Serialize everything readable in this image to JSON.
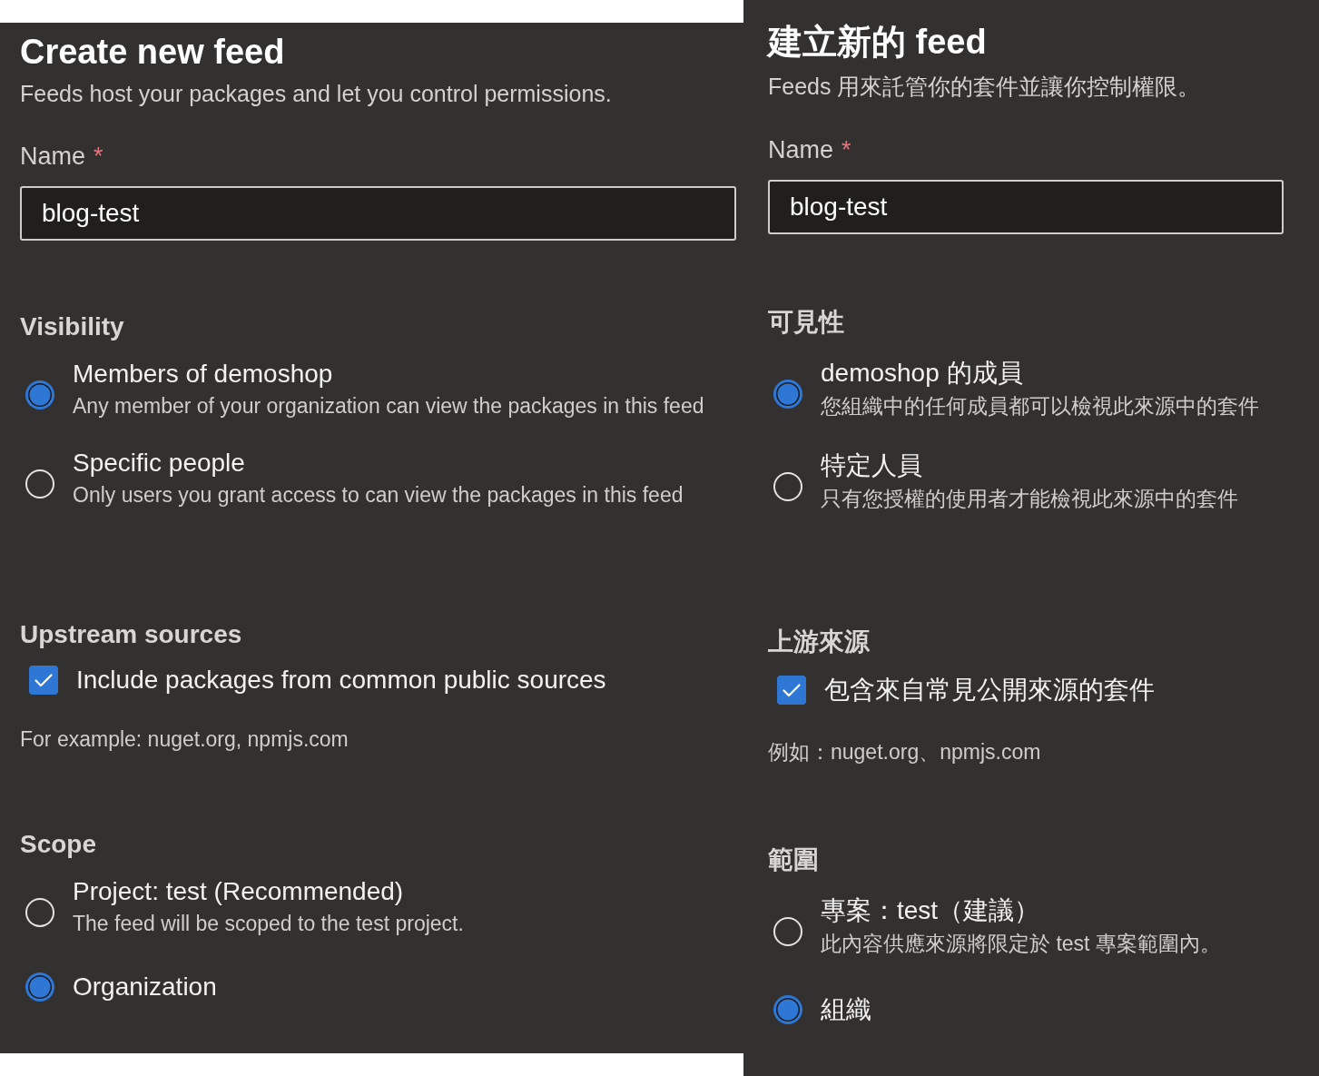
{
  "panels": [
    {
      "title": "Create new feed",
      "subtitle": "Feeds host your packages and let you control permissions.",
      "name_field": {
        "label": "Name",
        "required_mark": "*",
        "value": "blog-test"
      },
      "sections": [
        {
          "kind": "radio",
          "heading": "Visibility",
          "options": [
            {
              "label": "Members of demoshop",
              "description": "Any member of your organization can view the packages in this feed",
              "selected": true
            },
            {
              "label": "Specific people",
              "description": "Only users you grant access to can view the packages in this feed",
              "selected": false
            }
          ]
        },
        {
          "kind": "checkbox",
          "heading": "Upstream sources",
          "options": [
            {
              "label": "Include packages from common public sources",
              "checked": true
            }
          ],
          "note": "For example: nuget.org, npmjs.com"
        },
        {
          "kind": "radio",
          "heading": "Scope",
          "options": [
            {
              "label": "Project: test (Recommended)",
              "description": "The feed will be scoped to the test project.",
              "selected": false
            },
            {
              "label": "Organization",
              "selected": true
            }
          ]
        }
      ]
    },
    {
      "title": "建立新的 feed",
      "subtitle": "Feeds 用來託管你的套件並讓你控制權限。",
      "name_field": {
        "label": "Name",
        "required_mark": "*",
        "value": "blog-test"
      },
      "sections": [
        {
          "kind": "radio",
          "heading": "可見性",
          "options": [
            {
              "label": "demoshop 的成員",
              "description": "您組織中的任何成員都可以檢視此來源中的套件",
              "selected": true
            },
            {
              "label": "特定人員",
              "description": "只有您授權的使用者才能檢視此來源中的套件",
              "selected": false
            }
          ]
        },
        {
          "kind": "checkbox",
          "heading": "上游來源",
          "options": [
            {
              "label": "包含來自常見公開來源的套件",
              "checked": true
            }
          ],
          "note": "例如：nuget.org、npmjs.com"
        },
        {
          "kind": "radio",
          "heading": "範圍",
          "options": [
            {
              "label": "專案：test（建議）",
              "description": "此內容供應來源將限定於 test 專案範圍內。",
              "selected": false
            },
            {
              "label": "組織",
              "selected": true
            }
          ]
        }
      ]
    }
  ]
}
